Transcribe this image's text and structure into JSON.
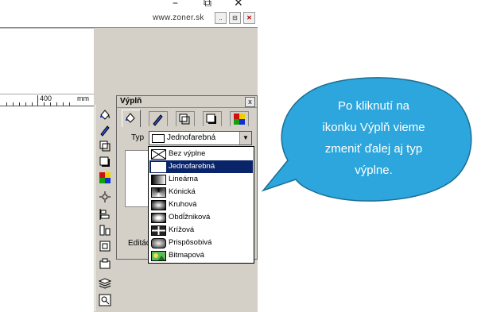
{
  "window": {
    "url_text": "www.zoner.sk",
    "minimize_glyph": "–",
    "restore_glyph": "⧉",
    "close_glyph": "✕",
    "mini_buttons": [
      "..",
      "⊟",
      "✕"
    ]
  },
  "ruler": {
    "label_400": "400",
    "unit": "mm"
  },
  "panel": {
    "title": "Výplň",
    "close_glyph": "x",
    "typ_label": "Typ",
    "type_value": "Jednofarebná",
    "edit_label": "Editác",
    "tabs": [
      "fill-tab",
      "outline-tab",
      "shadow-tab",
      "3d-tab",
      "color-tab"
    ]
  },
  "dropdown": {
    "items": [
      {
        "label": "Bez výplne",
        "icon": "no-fill-icon"
      },
      {
        "label": "Jednofarebná",
        "icon": "solid-fill-icon",
        "selected": true
      },
      {
        "label": "Lineárna",
        "icon": "linear-gradient-icon"
      },
      {
        "label": "Kónická",
        "icon": "conical-gradient-icon"
      },
      {
        "label": "Kruhová",
        "icon": "radial-gradient-icon"
      },
      {
        "label": "Obdĺžniková",
        "icon": "rectangular-gradient-icon"
      },
      {
        "label": "Krížová",
        "icon": "cross-gradient-icon"
      },
      {
        "label": "Prispôsobivá",
        "icon": "adaptive-gradient-icon"
      },
      {
        "label": "Bitmapová",
        "icon": "bitmap-fill-icon"
      }
    ]
  },
  "callout": {
    "text_line1": "Po kliknutí na",
    "text_line2": "ikonku Výplň vieme",
    "text_line3": "zmeniť ďalej aj typ",
    "text_line4": "výplne.",
    "fill_color": "#2ca6dc",
    "border_color": "#1c6e93"
  },
  "toolbar_icons": [
    "fill-bucket-icon",
    "pen-icon",
    "shadow-icon",
    "square-icon",
    "palette-icon",
    "move-icon",
    "align-icon",
    "distribute-icon",
    "transform-icon",
    "group-icon",
    "layers-icon",
    "zoom-object-icon"
  ]
}
